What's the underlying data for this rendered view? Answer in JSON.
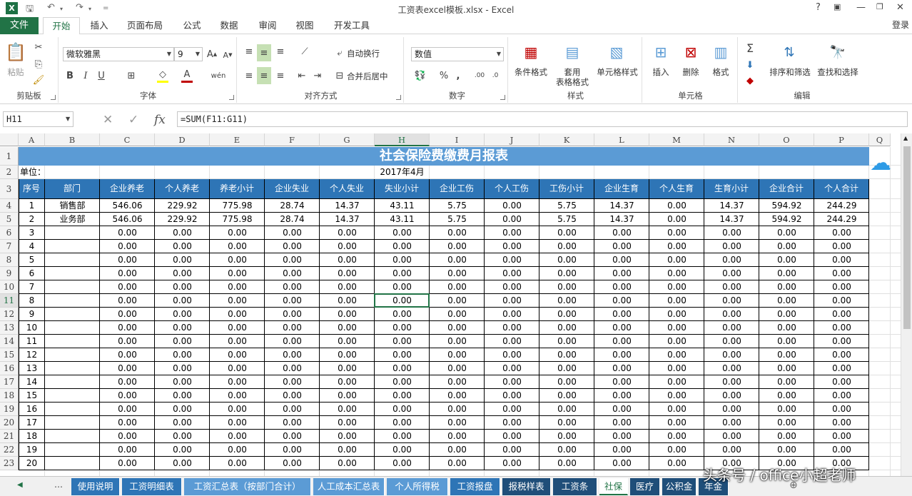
{
  "app": {
    "title": "工资表excel模板.xlsx - Excel",
    "logo": "X",
    "help": "?",
    "login": "登录"
  },
  "ribbon_tabs": [
    "文件",
    "开始",
    "插入",
    "页面布局",
    "公式",
    "数据",
    "审阅",
    "视图",
    "开发工具"
  ],
  "ribbon": {
    "clipboard": {
      "label": "剪贴板",
      "paste": "粘贴"
    },
    "font": {
      "label": "字体",
      "name": "微软雅黑",
      "size": "9",
      "bold": "B",
      "italic": "I",
      "underline": "U"
    },
    "alignment": {
      "label": "对齐方式",
      "wrap": "自动换行",
      "merge": "合并后居中"
    },
    "number": {
      "label": "数字",
      "format": "数值",
      "percent": "%",
      "comma": ","
    },
    "styles": {
      "label": "样式",
      "conditional": "条件格式",
      "table_line1": "套用",
      "table_line2": "表格格式",
      "cell_styles": "单元格样式"
    },
    "cells": {
      "label": "单元格",
      "insert": "插入",
      "delete": "删除",
      "format": "格式"
    },
    "editing": {
      "label": "编辑",
      "sort": "排序和筛选",
      "find": "查找和选择"
    }
  },
  "formula_bar": {
    "name_box": "H11",
    "fx": "fx",
    "formula": "=SUM(F11:G11)"
  },
  "columns": [
    "A",
    "B",
    "C",
    "D",
    "E",
    "F",
    "G",
    "H",
    "I",
    "J",
    "K",
    "L",
    "M",
    "N",
    "O",
    "P",
    "Q"
  ],
  "selected_cell": {
    "col": "H",
    "row": 11
  },
  "sheet": {
    "title": "社会保险费缴费月报表",
    "unit_label": "单位：",
    "date": "2017年4月",
    "headers": [
      "序号",
      "部门",
      "企业养老",
      "个人养老",
      "养老小计",
      "企业失业",
      "个人失业",
      "失业小计",
      "企业工伤",
      "个人工伤",
      "工伤小计",
      "企业生育",
      "个人生育",
      "生育小计",
      "企业合计",
      "个人合计"
    ],
    "rows": [
      [
        "1",
        "销售部",
        "546.06",
        "229.92",
        "775.98",
        "28.74",
        "14.37",
        "43.11",
        "5.75",
        "0.00",
        "5.75",
        "14.37",
        "0.00",
        "14.37",
        "594.92",
        "244.29"
      ],
      [
        "2",
        "业务部",
        "546.06",
        "229.92",
        "775.98",
        "28.74",
        "14.37",
        "43.11",
        "5.75",
        "0.00",
        "5.75",
        "14.37",
        "0.00",
        "14.37",
        "594.92",
        "244.29"
      ],
      [
        "3",
        "",
        "0.00",
        "0.00",
        "0.00",
        "0.00",
        "0.00",
        "0.00",
        "0.00",
        "0.00",
        "0.00",
        "0.00",
        "0.00",
        "0.00",
        "0.00",
        "0.00"
      ],
      [
        "4",
        "",
        "0.00",
        "0.00",
        "0.00",
        "0.00",
        "0.00",
        "0.00",
        "0.00",
        "0.00",
        "0.00",
        "0.00",
        "0.00",
        "0.00",
        "0.00",
        "0.00"
      ],
      [
        "5",
        "",
        "0.00",
        "0.00",
        "0.00",
        "0.00",
        "0.00",
        "0.00",
        "0.00",
        "0.00",
        "0.00",
        "0.00",
        "0.00",
        "0.00",
        "0.00",
        "0.00"
      ],
      [
        "6",
        "",
        "0.00",
        "0.00",
        "0.00",
        "0.00",
        "0.00",
        "0.00",
        "0.00",
        "0.00",
        "0.00",
        "0.00",
        "0.00",
        "0.00",
        "0.00",
        "0.00"
      ],
      [
        "7",
        "",
        "0.00",
        "0.00",
        "0.00",
        "0.00",
        "0.00",
        "0.00",
        "0.00",
        "0.00",
        "0.00",
        "0.00",
        "0.00",
        "0.00",
        "0.00",
        "0.00"
      ],
      [
        "8",
        "",
        "0.00",
        "0.00",
        "0.00",
        "0.00",
        "0.00",
        "0.00",
        "0.00",
        "0.00",
        "0.00",
        "0.00",
        "0.00",
        "0.00",
        "0.00",
        "0.00"
      ],
      [
        "9",
        "",
        "0.00",
        "0.00",
        "0.00",
        "0.00",
        "0.00",
        "0.00",
        "0.00",
        "0.00",
        "0.00",
        "0.00",
        "0.00",
        "0.00",
        "0.00",
        "0.00"
      ],
      [
        "10",
        "",
        "0.00",
        "0.00",
        "0.00",
        "0.00",
        "0.00",
        "0.00",
        "0.00",
        "0.00",
        "0.00",
        "0.00",
        "0.00",
        "0.00",
        "0.00",
        "0.00"
      ],
      [
        "11",
        "",
        "0.00",
        "0.00",
        "0.00",
        "0.00",
        "0.00",
        "0.00",
        "0.00",
        "0.00",
        "0.00",
        "0.00",
        "0.00",
        "0.00",
        "0.00",
        "0.00"
      ],
      [
        "12",
        "",
        "0.00",
        "0.00",
        "0.00",
        "0.00",
        "0.00",
        "0.00",
        "0.00",
        "0.00",
        "0.00",
        "0.00",
        "0.00",
        "0.00",
        "0.00",
        "0.00"
      ],
      [
        "13",
        "",
        "0.00",
        "0.00",
        "0.00",
        "0.00",
        "0.00",
        "0.00",
        "0.00",
        "0.00",
        "0.00",
        "0.00",
        "0.00",
        "0.00",
        "0.00",
        "0.00"
      ],
      [
        "14",
        "",
        "0.00",
        "0.00",
        "0.00",
        "0.00",
        "0.00",
        "0.00",
        "0.00",
        "0.00",
        "0.00",
        "0.00",
        "0.00",
        "0.00",
        "0.00",
        "0.00"
      ],
      [
        "15",
        "",
        "0.00",
        "0.00",
        "0.00",
        "0.00",
        "0.00",
        "0.00",
        "0.00",
        "0.00",
        "0.00",
        "0.00",
        "0.00",
        "0.00",
        "0.00",
        "0.00"
      ],
      [
        "16",
        "",
        "0.00",
        "0.00",
        "0.00",
        "0.00",
        "0.00",
        "0.00",
        "0.00",
        "0.00",
        "0.00",
        "0.00",
        "0.00",
        "0.00",
        "0.00",
        "0.00"
      ],
      [
        "17",
        "",
        "0.00",
        "0.00",
        "0.00",
        "0.00",
        "0.00",
        "0.00",
        "0.00",
        "0.00",
        "0.00",
        "0.00",
        "0.00",
        "0.00",
        "0.00",
        "0.00"
      ],
      [
        "18",
        "",
        "0.00",
        "0.00",
        "0.00",
        "0.00",
        "0.00",
        "0.00",
        "0.00",
        "0.00",
        "0.00",
        "0.00",
        "0.00",
        "0.00",
        "0.00",
        "0.00"
      ],
      [
        "19",
        "",
        "0.00",
        "0.00",
        "0.00",
        "0.00",
        "0.00",
        "0.00",
        "0.00",
        "0.00",
        "0.00",
        "0.00",
        "0.00",
        "0.00",
        "0.00",
        "0.00"
      ],
      [
        "20",
        "",
        "0.00",
        "0.00",
        "0.00",
        "0.00",
        "0.00",
        "0.00",
        "0.00",
        "0.00",
        "0.00",
        "0.00",
        "0.00",
        "0.00",
        "0.00",
        "0.00"
      ]
    ]
  },
  "row_numbers": [
    "1",
    "2",
    "3",
    "4",
    "5",
    "6",
    "7",
    "8",
    "9",
    "10",
    "11",
    "12",
    "13",
    "14",
    "15",
    "16",
    "17",
    "18",
    "19",
    "20",
    "21",
    "22",
    "23"
  ],
  "sheet_tabs": [
    {
      "label": "使用说明",
      "color": "#2e75b6"
    },
    {
      "label": "工资明细表",
      "color": "#2e75b6"
    },
    {
      "label": "工资汇总表（按部门合计）",
      "color": "#5b9bd5"
    },
    {
      "label": "人工成本汇总表",
      "color": "#5b9bd5"
    },
    {
      "label": "个人所得税",
      "color": "#5b9bd5"
    },
    {
      "label": "工资报盘",
      "color": "#2e75b6"
    },
    {
      "label": "报税样表",
      "color": "#1f4e79"
    },
    {
      "label": "工资条",
      "color": "#1f4e79"
    },
    {
      "label": "社保",
      "color": "#ffffff",
      "active": true
    },
    {
      "label": "医疗",
      "color": "#1f4e79"
    },
    {
      "label": "公积金",
      "color": "#1f4e79"
    },
    {
      "label": "年金",
      "color": "#1f4e79"
    }
  ],
  "watermark": "头条号 / office小超老师",
  "colors": {
    "accent": "#217346",
    "title_fill": "#5b9bd5",
    "header_fill": "#2e75b6"
  }
}
